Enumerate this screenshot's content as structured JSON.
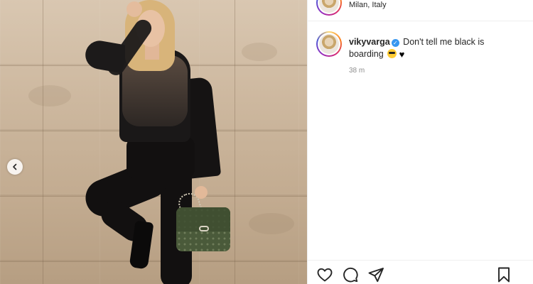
{
  "post": {
    "location": "Milan, Italy",
    "username": "vikyvarga",
    "verified": true,
    "caption_text": "Don't tell me black is boarding",
    "timestamp": "38 m"
  },
  "photo": {
    "carousel_prev_icon": "chevron-left-icon"
  },
  "actions": {
    "icons": [
      "heart-icon",
      "comment-icon",
      "share-icon",
      "bookmark-icon"
    ]
  },
  "colors": {
    "verified_badge": "#3897f0",
    "text": "#262626",
    "muted": "#8e8e8e",
    "divider": "#efefef"
  }
}
